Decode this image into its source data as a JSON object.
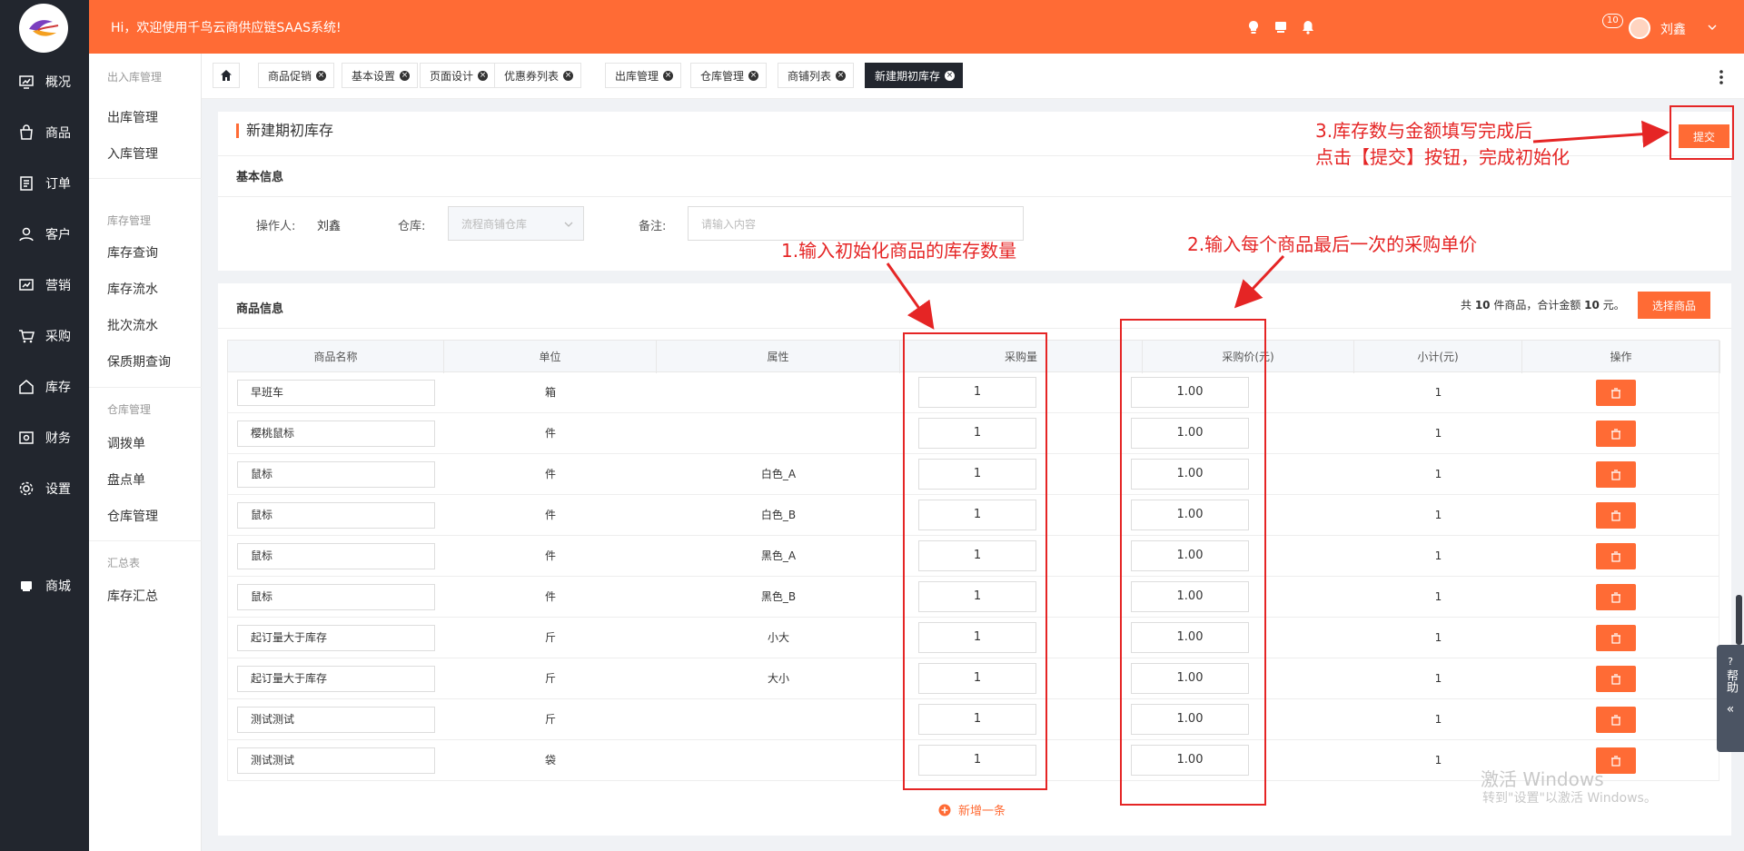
{
  "header": {
    "welcome": "Hi，欢迎使用千鸟云商供应链SAAS系统!",
    "notification_count": "10",
    "username": "刘鑫"
  },
  "sidebar": {
    "items": [
      {
        "label": "概况",
        "icon": "dashboard-icon"
      },
      {
        "label": "商品",
        "icon": "bag-icon"
      },
      {
        "label": "订单",
        "icon": "order-icon"
      },
      {
        "label": "客户",
        "icon": "user-icon"
      },
      {
        "label": "营销",
        "icon": "chart-icon"
      },
      {
        "label": "采购",
        "icon": "cart-icon"
      },
      {
        "label": "库存",
        "icon": "home-icon"
      },
      {
        "label": "财务",
        "icon": "wallet-icon"
      },
      {
        "label": "设置",
        "icon": "gear-icon"
      },
      {
        "label": "商城",
        "icon": "store-icon"
      }
    ]
  },
  "subnav": {
    "groups": [
      {
        "title": "出入库管理",
        "items": [
          "出库管理",
          "入库管理"
        ]
      },
      {
        "title": "库存管理",
        "items": [
          "库存查询",
          "库存流水",
          "批次流水",
          "保质期查询"
        ]
      },
      {
        "title": "仓库管理",
        "items": [
          "调拨单",
          "盘点单",
          "仓库管理"
        ]
      },
      {
        "title": "汇总表",
        "items": [
          "库存汇总"
        ]
      }
    ]
  },
  "tabs": [
    {
      "label": "商品促销"
    },
    {
      "label": "基本设置"
    },
    {
      "label": "页面设计"
    },
    {
      "label": "优惠券列表"
    },
    {
      "label": "出库管理"
    },
    {
      "label": "仓库管理"
    },
    {
      "label": "商铺列表"
    },
    {
      "label": "新建期初库存",
      "active": true
    }
  ],
  "page": {
    "title": "新建期初库存",
    "submit_label": "提交"
  },
  "basic_info": {
    "heading": "基本信息",
    "operator_label": "操作人:",
    "operator_value": "刘鑫",
    "warehouse_label": "仓库:",
    "warehouse_value": "流程商铺仓库",
    "note_label": "备注:",
    "note_placeholder": "请输入内容"
  },
  "goods_info": {
    "heading": "商品信息",
    "summary_prefix": "共 ",
    "summary_count": "10",
    "summary_mid": " 件商品，合计金额 ",
    "summary_amount": "10",
    "summary_suffix": " 元。",
    "choose_label": "选择商品",
    "add_row_label": "新增一条"
  },
  "table": {
    "headers": [
      "商品名称",
      "单位",
      "属性",
      "采购量",
      "采购价(元)",
      "小计(元)",
      "操作"
    ],
    "rows": [
      {
        "name": "早班车",
        "unit": "箱",
        "attr": "",
        "qty": "1",
        "price": "1.00",
        "subtotal": "1"
      },
      {
        "name": "樱桃鼠标",
        "unit": "件",
        "attr": "",
        "qty": "1",
        "price": "1.00",
        "subtotal": "1"
      },
      {
        "name": "鼠标",
        "unit": "件",
        "attr": "白色_A",
        "qty": "1",
        "price": "1.00",
        "subtotal": "1"
      },
      {
        "name": "鼠标",
        "unit": "件",
        "attr": "白色_B",
        "qty": "1",
        "price": "1.00",
        "subtotal": "1"
      },
      {
        "name": "鼠标",
        "unit": "件",
        "attr": "黑色_A",
        "qty": "1",
        "price": "1.00",
        "subtotal": "1"
      },
      {
        "name": "鼠标",
        "unit": "件",
        "attr": "黑色_B",
        "qty": "1",
        "price": "1.00",
        "subtotal": "1"
      },
      {
        "name": "起订量大于库存",
        "unit": "斤",
        "attr": "小大",
        "qty": "1",
        "price": "1.00",
        "subtotal": "1"
      },
      {
        "name": "起订量大于库存",
        "unit": "斤",
        "attr": "大小",
        "qty": "1",
        "price": "1.00",
        "subtotal": "1"
      },
      {
        "name": "测试测试",
        "unit": "斤",
        "attr": "",
        "qty": "1",
        "price": "1.00",
        "subtotal": "1"
      },
      {
        "name": "测试测试",
        "unit": "袋",
        "attr": "",
        "qty": "1",
        "price": "1.00",
        "subtotal": "1"
      }
    ]
  },
  "annotations": {
    "a1": "1.输入初始化商品的库存数量",
    "a2": "2.输入每个商品最后一次的采购单价",
    "a3_line1": "3.库存数与金额填写完成后",
    "a3_line2": "点击【提交】按钮，完成初始化"
  },
  "watermark": {
    "line1": "激活 Windows",
    "line2": "转到\"设置\"以激活 Windows。"
  },
  "help": {
    "label": "帮助"
  },
  "colors": {
    "accent": "#ff6b35",
    "sidebar": "#22262e",
    "annotation": "#e52525"
  }
}
